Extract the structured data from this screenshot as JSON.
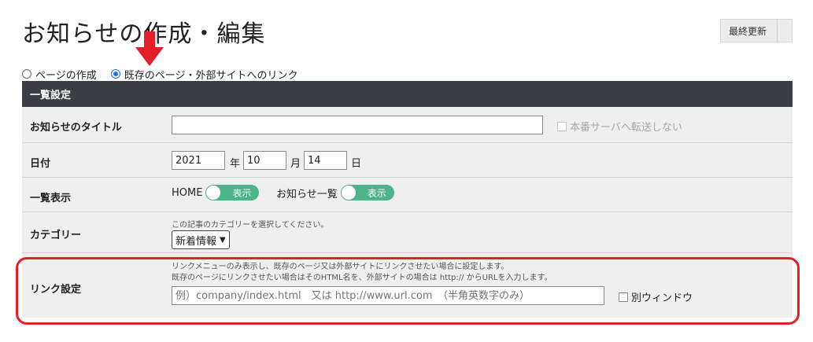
{
  "header": {
    "title": "お知らせの作成・編集",
    "last_update_button": "最終更新"
  },
  "mode": {
    "options": [
      {
        "label": "ページの作成",
        "checked": false
      },
      {
        "label": "既存のページ・外部サイトへのリンク",
        "checked": true
      }
    ]
  },
  "section": {
    "title": "一覧設定"
  },
  "form": {
    "title_row": {
      "label": "お知らせのタイトル",
      "value": "",
      "no_transfer_label": "本番サーバへ転送しない"
    },
    "date_row": {
      "label": "日付",
      "year": "2021",
      "year_unit": "年",
      "month": "10",
      "month_unit": "月",
      "day": "14",
      "day_unit": "日"
    },
    "list_row": {
      "label": "一覧表示",
      "home_label": "HOME",
      "home_toggle": "表示",
      "news_label": "お知らせ一覧",
      "news_toggle": "表示"
    },
    "category_row": {
      "label": "カテゴリー",
      "help": "この記事のカテゴリーを選択してください。",
      "selected": "新着情報"
    },
    "link_row": {
      "label": "リンク設定",
      "help_line1": "リンクメニューのみ表示し、既存のページ又は外部サイトにリンクさせたい場合に設定します。",
      "help_line2": "既存のページにリンクさせたい場合はそのHTML名を、外部サイトの場合は http:// からURLを入力します。",
      "placeholder": "例）company/index.html　又は http://www.url.com　（半角英数字のみ）",
      "new_window_label": "別ウィンドウ"
    }
  },
  "colors": {
    "header_bar": "#3a3d42",
    "toggle_on": "#4db38a",
    "highlight": "#e3202a",
    "radio_selected": "#1a73e8"
  }
}
